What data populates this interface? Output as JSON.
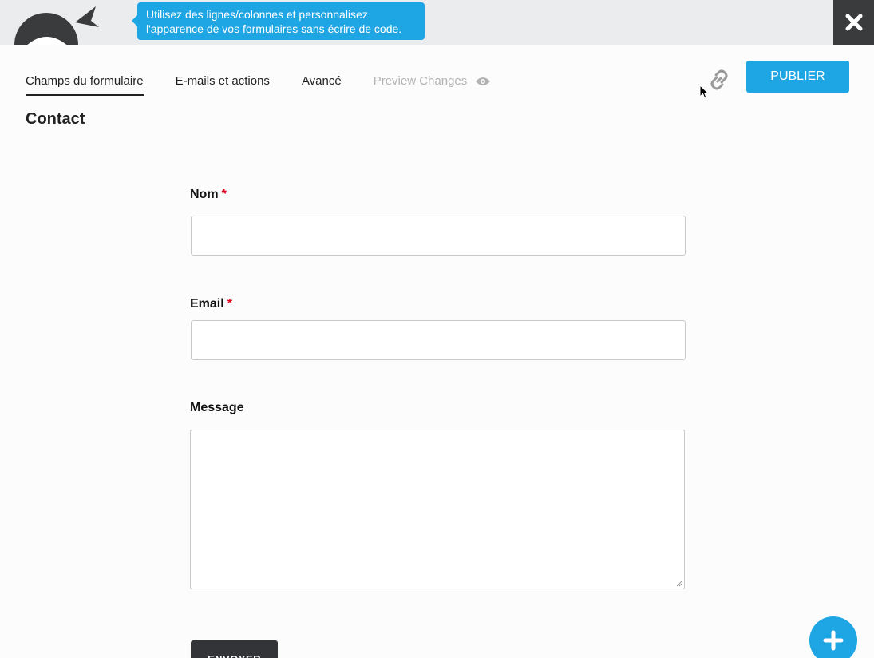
{
  "header": {
    "tooltip_line1": "Utilisez des lignes/colonnes et personnalisez",
    "tooltip_line2": "l'apparence de vos formulaires sans écrire de code."
  },
  "tabs": [
    {
      "label": "Champs du formulaire",
      "active": true
    },
    {
      "label": "E-mails et actions",
      "active": false
    },
    {
      "label": "Avancé",
      "active": false
    },
    {
      "label": "Preview Changes",
      "active": false
    }
  ],
  "toolbar": {
    "publish_label": "PUBLIER"
  },
  "form": {
    "title": "Contact",
    "fields": [
      {
        "label": "Nom",
        "required_mark": "*",
        "type": "text"
      },
      {
        "label": "Email",
        "required_mark": "*",
        "type": "text"
      },
      {
        "label": "Message",
        "type": "textarea"
      }
    ],
    "submit_label": "ENVOYER"
  },
  "icons": {
    "mascot": "ninja-mascot-icon",
    "close": "close-icon",
    "preview": "eye-icon",
    "link": "link-icon",
    "add": "plus-icon"
  },
  "colors": {
    "accent": "#1ea5e4",
    "topbar": "#ebecee",
    "close_bg": "#3a3b3d",
    "required": "#e0001b",
    "submit_bg": "#333438"
  }
}
